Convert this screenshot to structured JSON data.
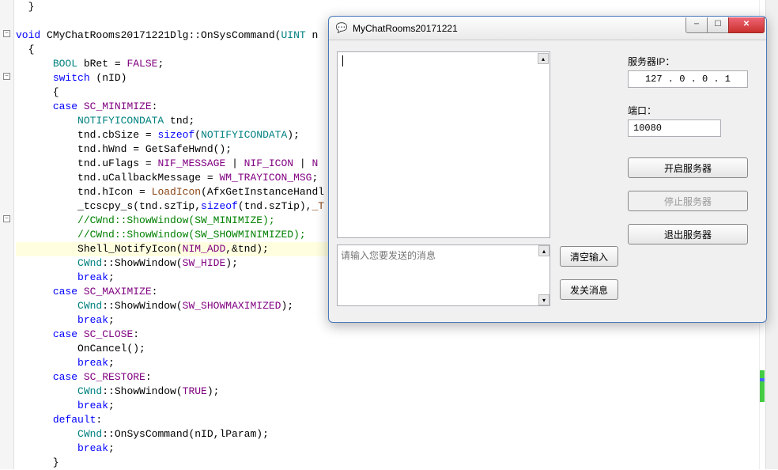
{
  "code": {
    "lines": [
      {
        "raw": "  }"
      },
      {
        "raw": ""
      },
      {
        "seg": [
          {
            "c": "kw-blue",
            "t": "void"
          },
          {
            "c": "plain",
            "t": " CMyChatRooms20171221Dlg::OnSysCommand("
          },
          {
            "c": "kw-teal",
            "t": "UINT"
          },
          {
            "c": "plain",
            "t": " n"
          }
        ]
      },
      {
        "raw": "  {"
      },
      {
        "seg": [
          {
            "c": "plain",
            "t": "      "
          },
          {
            "c": "kw-teal",
            "t": "BOOL"
          },
          {
            "c": "plain",
            "t": " bRet = "
          },
          {
            "c": "kw-purple",
            "t": "FALSE"
          },
          {
            "c": "plain",
            "t": ";"
          }
        ]
      },
      {
        "seg": [
          {
            "c": "plain",
            "t": "      "
          },
          {
            "c": "kw-blue",
            "t": "switch"
          },
          {
            "c": "plain",
            "t": " (nID)"
          }
        ]
      },
      {
        "raw": "      {"
      },
      {
        "seg": [
          {
            "c": "plain",
            "t": "      "
          },
          {
            "c": "kw-blue",
            "t": "case"
          },
          {
            "c": "plain",
            "t": " "
          },
          {
            "c": "kw-purple",
            "t": "SC_MINIMIZE"
          },
          {
            "c": "plain",
            "t": ":"
          }
        ]
      },
      {
        "seg": [
          {
            "c": "plain",
            "t": "          "
          },
          {
            "c": "kw-teal",
            "t": "NOTIFYICONDATA"
          },
          {
            "c": "plain",
            "t": " tnd;"
          }
        ]
      },
      {
        "seg": [
          {
            "c": "plain",
            "t": "          tnd.cbSize = "
          },
          {
            "c": "kw-blue",
            "t": "sizeof"
          },
          {
            "c": "plain",
            "t": "("
          },
          {
            "c": "kw-teal",
            "t": "NOTIFYICONDATA"
          },
          {
            "c": "plain",
            "t": ");"
          }
        ]
      },
      {
        "seg": [
          {
            "c": "plain",
            "t": "          tnd.hWnd = GetSafeHwnd();"
          }
        ]
      },
      {
        "seg": [
          {
            "c": "plain",
            "t": "          tnd.uFlags = "
          },
          {
            "c": "kw-purple",
            "t": "NIF_MESSAGE"
          },
          {
            "c": "plain",
            "t": " | "
          },
          {
            "c": "kw-purple",
            "t": "NIF_ICON"
          },
          {
            "c": "plain",
            "t": " | "
          },
          {
            "c": "kw-purple",
            "t": "N"
          }
        ]
      },
      {
        "seg": [
          {
            "c": "plain",
            "t": "          tnd.uCallbackMessage = "
          },
          {
            "c": "kw-purple",
            "t": "WM_TRAYICON_MSG"
          },
          {
            "c": "plain",
            "t": ";"
          }
        ]
      },
      {
        "seg": [
          {
            "c": "plain",
            "t": "          tnd.hIcon = "
          },
          {
            "c": "kw-brown",
            "t": "LoadIcon"
          },
          {
            "c": "plain",
            "t": "(AfxGetInstanceHandl"
          }
        ]
      },
      {
        "seg": [
          {
            "c": "plain",
            "t": "          _tcscpy_s(tnd.szTip,"
          },
          {
            "c": "kw-blue",
            "t": "sizeof"
          },
          {
            "c": "plain",
            "t": "(tnd.szTip),"
          },
          {
            "c": "kw-brown",
            "t": "_T"
          }
        ]
      },
      {
        "seg": [
          {
            "c": "comment",
            "t": "          //CWnd::ShowWindow(SW_MINIMIZE);"
          }
        ]
      },
      {
        "seg": [
          {
            "c": "comment",
            "t": "          //CWnd::ShowWindow(SW_SHOWMINIMIZED);"
          }
        ]
      },
      {
        "seg": [
          {
            "c": "plain",
            "t": "          Shell_NotifyIcon("
          },
          {
            "c": "kw-purple",
            "t": "NIM_ADD"
          },
          {
            "c": "plain",
            "t": ",&tnd);"
          }
        ],
        "current": true
      },
      {
        "seg": [
          {
            "c": "plain",
            "t": "          "
          },
          {
            "c": "kw-teal",
            "t": "CWnd"
          },
          {
            "c": "plain",
            "t": "::ShowWindow("
          },
          {
            "c": "kw-purple",
            "t": "SW_HIDE"
          },
          {
            "c": "plain",
            "t": ");"
          }
        ]
      },
      {
        "seg": [
          {
            "c": "plain",
            "t": "          "
          },
          {
            "c": "kw-blue",
            "t": "break"
          },
          {
            "c": "plain",
            "t": ";"
          }
        ]
      },
      {
        "seg": [
          {
            "c": "plain",
            "t": "      "
          },
          {
            "c": "kw-blue",
            "t": "case"
          },
          {
            "c": "plain",
            "t": " "
          },
          {
            "c": "kw-purple",
            "t": "SC_MAXIMIZE"
          },
          {
            "c": "plain",
            "t": ":"
          }
        ]
      },
      {
        "seg": [
          {
            "c": "plain",
            "t": "          "
          },
          {
            "c": "kw-teal",
            "t": "CWnd"
          },
          {
            "c": "plain",
            "t": "::ShowWindow("
          },
          {
            "c": "kw-purple",
            "t": "SW_SHOWMAXIMIZED"
          },
          {
            "c": "plain",
            "t": ");"
          }
        ]
      },
      {
        "seg": [
          {
            "c": "plain",
            "t": "          "
          },
          {
            "c": "kw-blue",
            "t": "break"
          },
          {
            "c": "plain",
            "t": ";"
          }
        ]
      },
      {
        "seg": [
          {
            "c": "plain",
            "t": "      "
          },
          {
            "c": "kw-blue",
            "t": "case"
          },
          {
            "c": "plain",
            "t": " "
          },
          {
            "c": "kw-purple",
            "t": "SC_CLOSE"
          },
          {
            "c": "plain",
            "t": ":"
          }
        ]
      },
      {
        "seg": [
          {
            "c": "plain",
            "t": "          OnCancel();"
          }
        ]
      },
      {
        "seg": [
          {
            "c": "plain",
            "t": "          "
          },
          {
            "c": "kw-blue",
            "t": "break"
          },
          {
            "c": "plain",
            "t": ";"
          }
        ]
      },
      {
        "seg": [
          {
            "c": "plain",
            "t": "      "
          },
          {
            "c": "kw-blue",
            "t": "case"
          },
          {
            "c": "plain",
            "t": " "
          },
          {
            "c": "kw-purple",
            "t": "SC_RESTORE"
          },
          {
            "c": "plain",
            "t": ":"
          }
        ]
      },
      {
        "seg": [
          {
            "c": "plain",
            "t": "          "
          },
          {
            "c": "kw-teal",
            "t": "CWnd"
          },
          {
            "c": "plain",
            "t": "::ShowWindow("
          },
          {
            "c": "kw-purple",
            "t": "TRUE"
          },
          {
            "c": "plain",
            "t": ");"
          }
        ]
      },
      {
        "seg": [
          {
            "c": "plain",
            "t": "          "
          },
          {
            "c": "kw-blue",
            "t": "break"
          },
          {
            "c": "plain",
            "t": ";"
          }
        ]
      },
      {
        "seg": [
          {
            "c": "plain",
            "t": "      "
          },
          {
            "c": "kw-blue",
            "t": "default"
          },
          {
            "c": "plain",
            "t": ":"
          }
        ]
      },
      {
        "seg": [
          {
            "c": "plain",
            "t": "          "
          },
          {
            "c": "kw-teal",
            "t": "CWnd"
          },
          {
            "c": "plain",
            "t": "::OnSysCommand(nID,lParam);"
          }
        ]
      },
      {
        "seg": [
          {
            "c": "plain",
            "t": "          "
          },
          {
            "c": "kw-blue",
            "t": "break"
          },
          {
            "c": "plain",
            "t": ";"
          }
        ]
      },
      {
        "raw": "      }"
      }
    ],
    "folds": [
      2,
      5,
      15
    ]
  },
  "dialog": {
    "title": "MyChatRooms20171221",
    "icon": "💬",
    "input_placeholder": "请输入您要发送的消息",
    "labels": {
      "ip": "服务器IP：",
      "port": "端口："
    },
    "ip": "127 .  0  .  0  .  1",
    "port": "10080",
    "buttons": {
      "clear": "清空输入",
      "send": "发关消息",
      "start": "开启服务器",
      "stop": "停止服务器",
      "exit": "退出服务器"
    }
  }
}
